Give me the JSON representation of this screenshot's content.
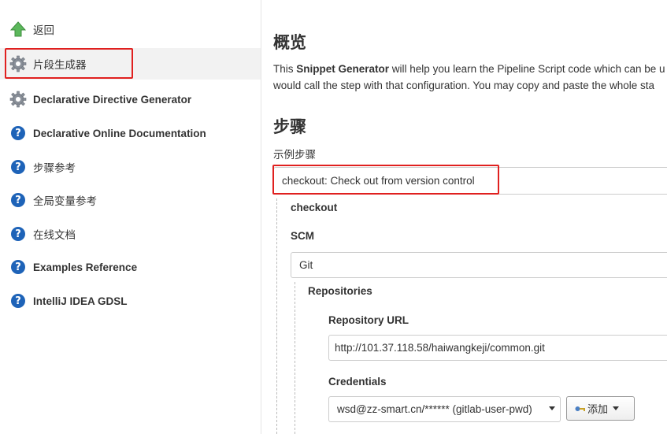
{
  "sidebar": {
    "items": [
      {
        "label": "返回",
        "icon": "up-arrow-icon"
      },
      {
        "label": "片段生成器",
        "icon": "gear-icon"
      },
      {
        "label": "Declarative Directive Generator",
        "icon": "gear-icon"
      },
      {
        "label": "Declarative Online Documentation",
        "icon": "help-icon"
      },
      {
        "label": "步骤参考",
        "icon": "help-icon"
      },
      {
        "label": "全局变量参考",
        "icon": "help-icon"
      },
      {
        "label": "在线文档",
        "icon": "help-icon"
      },
      {
        "label": "Examples Reference",
        "icon": "help-icon"
      },
      {
        "label": "IntelliJ IDEA GDSL",
        "icon": "help-icon"
      }
    ],
    "help_glyph": "?"
  },
  "main": {
    "overview_title": "概览",
    "desc": {
      "part1": "This ",
      "bold": "Snippet Generator",
      "part2": " will help you learn the Pipeline Script code which can be u",
      "line2": "would call the step with that configuration. You may copy and paste the whole sta"
    },
    "steps_title": "步骤",
    "sample_step_label": "示例步骤",
    "sample_step_value": "checkout: Check out from version control",
    "checkout_label": "checkout",
    "scm_label": "SCM",
    "scm_value": "Git",
    "repositories_label": "Repositories",
    "repo_url_label": "Repository URL",
    "repo_url_value": "http://101.37.118.58/haiwangkeji/common.git",
    "credentials_label": "Credentials",
    "credentials_value": "wsd@zz-smart.cn/****** (gitlab-user-pwd)",
    "add_button_label": "添加"
  },
  "colors": {
    "highlight_border": "#e0201f",
    "help_icon": "#1e63b8",
    "up_arrow": "#5cb85c"
  }
}
